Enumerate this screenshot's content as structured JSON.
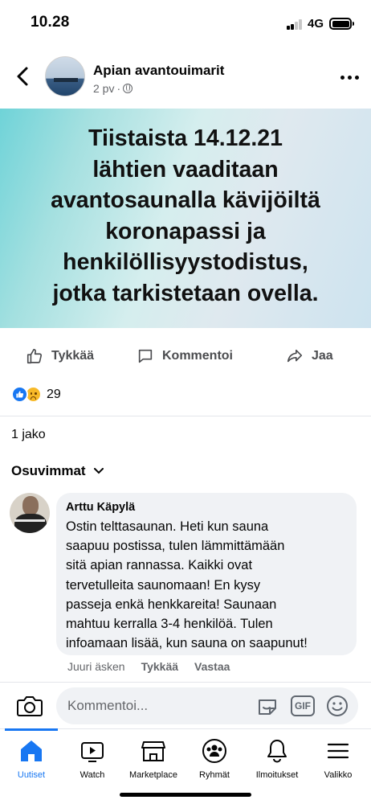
{
  "status_bar": {
    "time": "10.28",
    "network": "4G"
  },
  "post": {
    "group_name": "Apian avantouimarit",
    "time_ago": "2 pv",
    "privacy_separator": "·",
    "banner_lines": [
      "Tiistaista 14.12.21",
      "lähtien vaaditaan",
      "avantosaunalla kävijöiltä",
      "koronapassi ja",
      "henkilöllisyystodistus,",
      "jotka tarkistetaan ovella."
    ]
  },
  "actions": {
    "like": "Tykkää",
    "comment": "Kommentoi",
    "share": "Jaa"
  },
  "reactions": {
    "count": "29"
  },
  "shares": "1 jako",
  "comments_sort": "Osuvimmat",
  "comment": {
    "author": "Arttu Käpylä",
    "text": "Ostin telttasaunan. Heti kun sauna\nsaapuu postissa, tulen lämmittämään\nsitä apian rannassa. Kaikki ovat\ntervetulleita saunomaan! En kysy\npasseja enkä henkkareita! Saunaan\nmahtuu kerralla 3-4 henkilöä. Tulen\ninfoamaan lisää, kun sauna on saapunut!",
    "time": "Juuri äsken",
    "like": "Tykkää",
    "reply": "Vastaa"
  },
  "composer": {
    "placeholder": "Kommentoi...",
    "gif_label": "GIF"
  },
  "nav": {
    "items": [
      {
        "label": "Uutiset",
        "icon": "home-icon"
      },
      {
        "label": "Watch",
        "icon": "watch-icon"
      },
      {
        "label": "Marketplace",
        "icon": "marketplace-icon"
      },
      {
        "label": "Ryhmät",
        "icon": "groups-icon"
      },
      {
        "label": "Ilmoitukset",
        "icon": "bell-icon"
      },
      {
        "label": "Valikko",
        "icon": "menu-icon"
      }
    ]
  },
  "colors": {
    "accent": "#1877f2",
    "secondary_text": "#65676b",
    "bubble": "#f0f2f5"
  }
}
